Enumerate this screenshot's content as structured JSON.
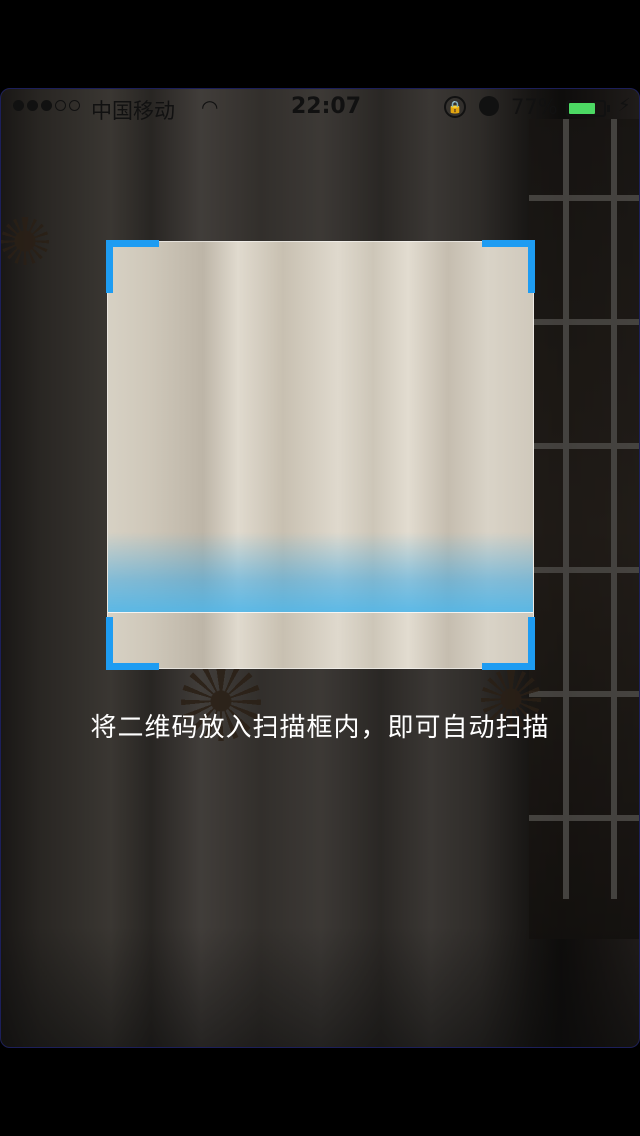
{
  "status_bar": {
    "carrier": "中国移动",
    "time": "22:07",
    "battery_percent": "77%",
    "battery_level": 0.77,
    "battery_color": "#4cd964",
    "wifi_icon": "wifi-icon",
    "lock_icon": "orientation-lock-icon",
    "alarm_icon": "alarm-icon",
    "charging_icon": "charging-bolt-icon"
  },
  "scanner": {
    "hint": "将二维码放入扫描框内，即可自动扫描",
    "corner_color": "#1e9cf2",
    "scan_line_color": "#46b4eb"
  }
}
